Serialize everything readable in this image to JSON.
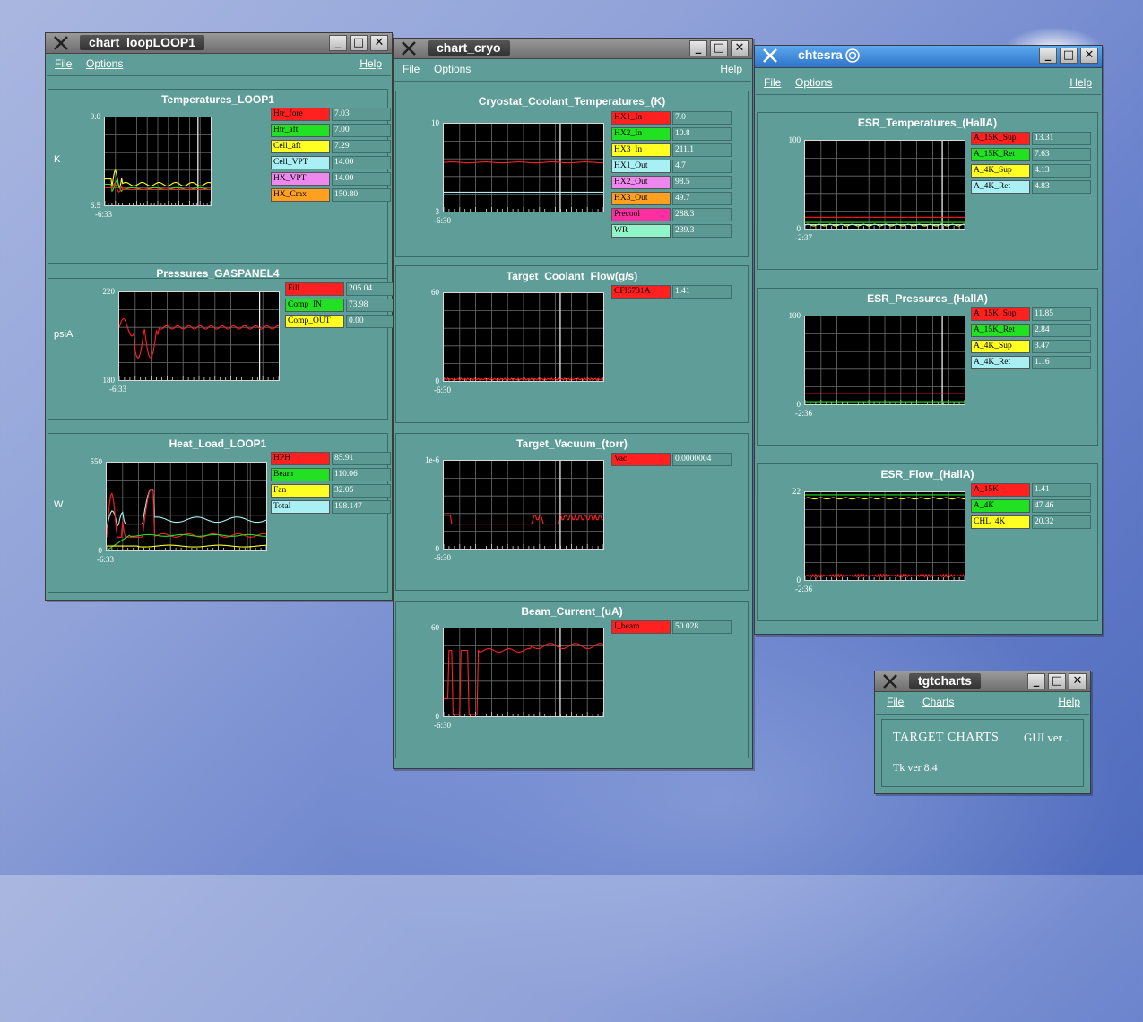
{
  "windows": [
    {
      "id": "loop1",
      "title": "chart_loopLOOP1",
      "active": false,
      "menu": [
        "File",
        "Options",
        "Help"
      ],
      "panels": [
        {
          "title": "Temperatures_LOOP1",
          "unit": "K",
          "ymax": "9.0",
          "ymin": "6.5",
          "xlabel": "-6:33",
          "ylim": [
            6.5,
            9.0
          ],
          "legend": [
            {
              "name": "Htr_fore",
              "value": "7.03",
              "color": "#ff2020"
            },
            {
              "name": "Htr_aft",
              "value": "7.00",
              "color": "#22e022"
            },
            {
              "name": "Cell_aft",
              "value": "7.29",
              "color": "#ffff22"
            },
            {
              "name": "Cell_VPT",
              "value": "14.00",
              "color": "#a8f0f4"
            },
            {
              "name": "HX_VPT",
              "value": "14.00",
              "color": "#ee88ee"
            },
            {
              "name": "HX_Cmx",
              "value": "150.80",
              "color": "#ffa020"
            }
          ]
        },
        {
          "title": "Pressures_GASPANEL4",
          "unit": "psiA",
          "ymax": "220",
          "ymin": "180",
          "xlabel": "-6:33",
          "ylim": [
            180,
            220
          ],
          "legend": [
            {
              "name": "Fill",
              "value": "205.04",
              "color": "#ff2020"
            },
            {
              "name": "Comp_IN",
              "value": "73.98",
              "color": "#22e022"
            },
            {
              "name": "Comp_OUT",
              "value": "0.00",
              "color": "#ffff22"
            }
          ]
        },
        {
          "title": "Heat_Load_LOOP1",
          "unit": "W",
          "ymax": "550",
          "ymin": "0",
          "xlabel": "-6:33",
          "ylim": [
            0,
            550
          ],
          "legend": [
            {
              "name": "HPH",
              "value": "85.91",
              "color": "#ff2020"
            },
            {
              "name": "Beam",
              "value": "110.06",
              "color": "#22e022"
            },
            {
              "name": "Fan",
              "value": "32.05",
              "color": "#ffff22"
            },
            {
              "name": "Total",
              "value": "198.147",
              "color": "#a8f0f4"
            }
          ]
        }
      ]
    },
    {
      "id": "cryo",
      "title": "chart_cryo",
      "active": false,
      "menu": [
        "File",
        "Options",
        "Help"
      ],
      "panels": [
        {
          "title": "Cryostat_Coolant_Temperatures_(K)",
          "unit": "",
          "ymax": "10",
          "ymin": "3",
          "xlabel": "-6:30",
          "ylim": [
            3,
            10
          ],
          "legend": [
            {
              "name": "HX1_In",
              "value": "7.0",
              "color": "#ff2020"
            },
            {
              "name": "HX2_In",
              "value": "10.8",
              "color": "#22e022"
            },
            {
              "name": "HX3_In",
              "value": "211.1",
              "color": "#ffff22"
            },
            {
              "name": "HX1_Out",
              "value": "4.7",
              "color": "#a8f0f4"
            },
            {
              "name": "HX2_Out",
              "value": "98.5",
              "color": "#ee88ee"
            },
            {
              "name": "HX3_Out",
              "value": "49.7",
              "color": "#ffa020"
            },
            {
              "name": "Precool",
              "value": "288.3",
              "color": "#ff2ea0"
            },
            {
              "name": "WR",
              "value": "239.3",
              "color": "#90f5c8"
            }
          ]
        },
        {
          "title": "Target_Coolant_Flow(g/s)",
          "unit": "",
          "ymax": "60",
          "ymin": "0",
          "xlabel": "-6:30",
          "ylim": [
            0,
            60
          ],
          "legend": [
            {
              "name": "CFI6731A",
              "value": "1.41",
              "color": "#ff2020"
            }
          ]
        },
        {
          "title": "Target_Vacuum_(torr)",
          "unit": "",
          "ymax": "1e-6",
          "ymin": "0",
          "xlabel": "-6:30",
          "ylim": [
            0,
            1
          ],
          "legend": [
            {
              "name": "Vac",
              "value": "0.0000004",
              "color": "#ff2020"
            }
          ]
        },
        {
          "title": "Beam_Current_(uA)",
          "unit": "",
          "ymax": "60",
          "ymin": "0",
          "xlabel": "-6:30",
          "ylim": [
            0,
            60
          ],
          "legend": [
            {
              "name": "I_beam",
              "value": "50.028",
              "color": "#ff2020"
            }
          ]
        }
      ]
    },
    {
      "id": "esr",
      "title": "chtesra",
      "active": true,
      "menu": [
        "File",
        "Options",
        "Help"
      ],
      "panels": [
        {
          "title": "ESR_Temperatures_(HallA)",
          "unit": "",
          "ymax": "100",
          "ymin": "0",
          "xlabel": "-2:37",
          "ylim": [
            0,
            100
          ],
          "legend": [
            {
              "name": "A_15K_Sup",
              "value": "13.31",
              "color": "#ff2020"
            },
            {
              "name": "A_15K_Ret",
              "value": "7.63",
              "color": "#22e022"
            },
            {
              "name": "A_4K_Sup",
              "value": "4.13",
              "color": "#ffff22"
            },
            {
              "name": "A_4K_Ret",
              "value": "4.83",
              "color": "#a8f0f4"
            }
          ]
        },
        {
          "title": "ESR_Pressures_(HallA)",
          "unit": "",
          "ymax": "100",
          "ymin": "0",
          "xlabel": "-2:36",
          "ylim": [
            0,
            100
          ],
          "legend": [
            {
              "name": "A_15K_Sup",
              "value": "11.85",
              "color": "#ff2020"
            },
            {
              "name": "A_15K_Ret",
              "value": "2.84",
              "color": "#22e022"
            },
            {
              "name": "A_4K_Sup",
              "value": "3.47",
              "color": "#ffff22"
            },
            {
              "name": "A_4K_Ret",
              "value": "1.16",
              "color": "#a8f0f4"
            }
          ]
        },
        {
          "title": "ESR_Flow_(HallA)",
          "unit": "",
          "ymax": "22",
          "ymin": "0",
          "xlabel": "-2:36",
          "ylim": [
            0,
            22
          ],
          "legend": [
            {
              "name": "A_15K",
              "value": "1.41",
              "color": "#ff2020"
            },
            {
              "name": "A_4K",
              "value": "47.46",
              "color": "#22e022"
            },
            {
              "name": "CHL_4K",
              "value": "20.32",
              "color": "#ffff22"
            }
          ]
        }
      ]
    }
  ],
  "about": {
    "title": "tgtcharts",
    "menu": [
      "File",
      "Charts",
      "Help"
    ],
    "heading": "TARGET CHARTS",
    "gui_ver": "GUI ver .",
    "tk_ver": "Tk ver 8.4"
  },
  "icons": {
    "window_logo": "x-logo-icon",
    "minimize": "minimize-icon",
    "maximize": "maximize-icon",
    "close": "close-icon",
    "app": "swirl-icon"
  }
}
